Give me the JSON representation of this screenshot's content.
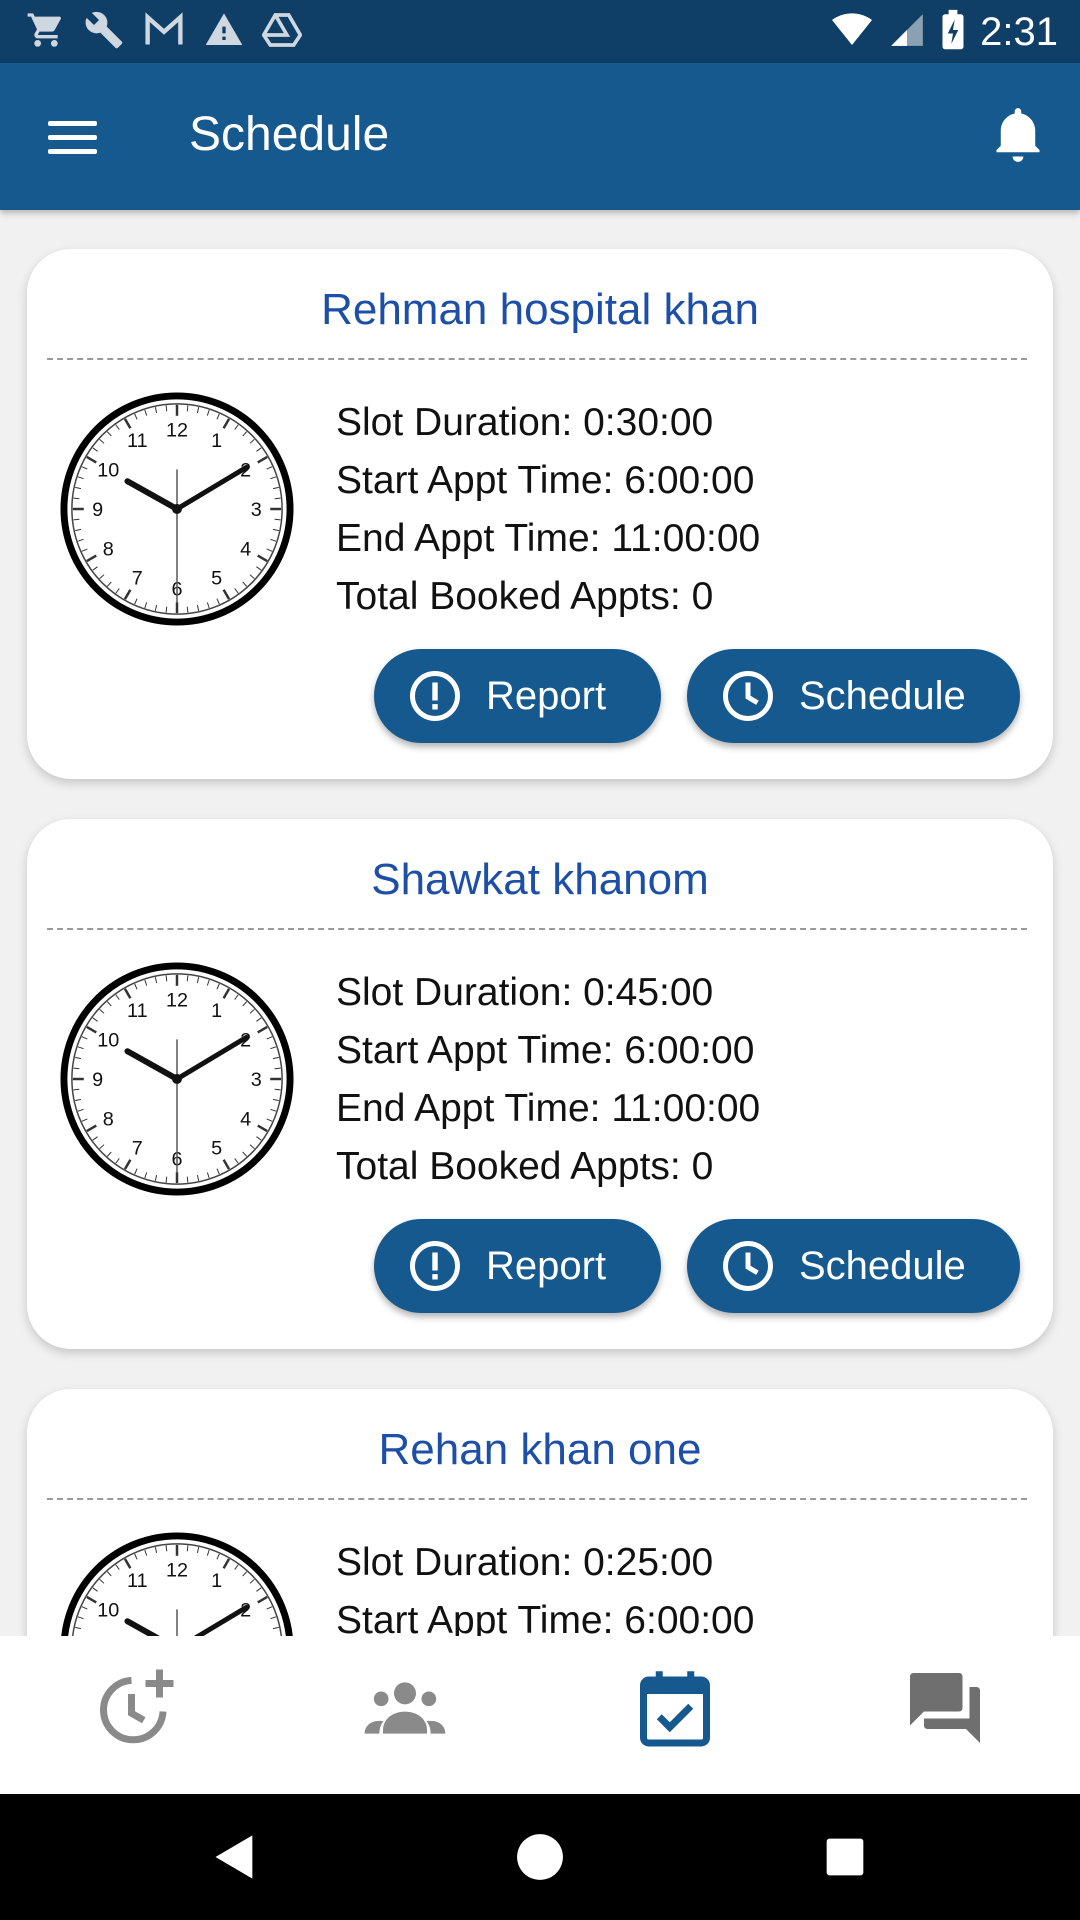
{
  "status_bar": {
    "time": "2:31",
    "left_icons": [
      "cart-icon",
      "wrench-icon",
      "gmail-icon",
      "warning-icon",
      "drive-icon"
    ],
    "right_icons": [
      "wifi-icon",
      "signal-icon",
      "battery-icon"
    ]
  },
  "app_bar": {
    "title": "Schedule",
    "color": "#15598f"
  },
  "cards": [
    {
      "title": "Rehman hospital khan",
      "lines": [
        "Slot Duration: 0:30:00",
        "Start Appt Time: 6:00:00",
        "End Appt Time: 11:00:00",
        "Total Booked Appts: 0"
      ],
      "report_label": "Report",
      "schedule_label": "Schedule"
    },
    {
      "title": "Shawkat khanom",
      "lines": [
        "Slot Duration: 0:45:00",
        "Start Appt Time: 6:00:00",
        "End Appt Time: 11:00:00",
        "Total Booked Appts: 0"
      ],
      "report_label": "Report",
      "schedule_label": "Schedule"
    },
    {
      "title": "Rehan khan one",
      "lines": [
        "Slot Duration: 0:25:00",
        "Start Appt Time: 6:00:00",
        "",
        ""
      ],
      "report_label": "",
      "schedule_label": ""
    }
  ],
  "bottom_nav": {
    "items": [
      "add-schedule-icon",
      "patients-icon",
      "calendar-check-icon",
      "chat-icon"
    ],
    "active_index": 2,
    "active_color": "#15598f",
    "inactive_color": "#8a8a8a"
  },
  "system_nav": [
    "back-icon",
    "home-icon",
    "recents-icon"
  ]
}
